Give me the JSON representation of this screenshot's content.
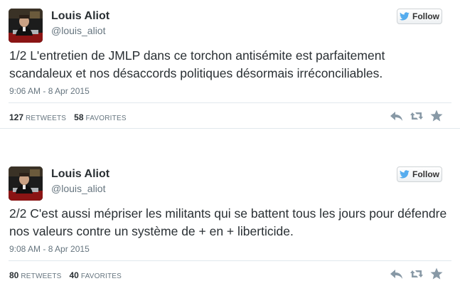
{
  "follow_label": "Follow",
  "colors": {
    "name": "#292f33",
    "muted": "#66757f",
    "twitter_blue": "#55acee",
    "icon_gray": "#8899a6"
  },
  "icons": {
    "follow": "twitter-bird-icon",
    "reply": "reply-icon",
    "retweet": "retweet-icon",
    "favorite": "star-icon"
  },
  "tweets": [
    {
      "author_name": "Louis Aliot",
      "author_handle": "@louis_aliot",
      "text": "1/2 L'entretien de JMLP dans ce torchon antisémite est parfaitement scandaleux et nos désaccords politiques désormais irréconciliables.",
      "timestamp": "9:06 AM - 8 Apr 2015",
      "retweets_count": "127",
      "retweets_label": "RETWEETS",
      "favorites_count": "58",
      "favorites_label": "FAVORITES"
    },
    {
      "author_name": "Louis Aliot",
      "author_handle": "@louis_aliot",
      "text": "2/2 C'est aussi mépriser les militants qui se battent tous les jours pour défendre nos valeurs contre un système de + en + liberticide.",
      "timestamp": "9:08 AM - 8 Apr 2015",
      "retweets_count": "80",
      "retweets_label": "RETWEETS",
      "favorites_count": "40",
      "favorites_label": "FAVORITES"
    }
  ]
}
